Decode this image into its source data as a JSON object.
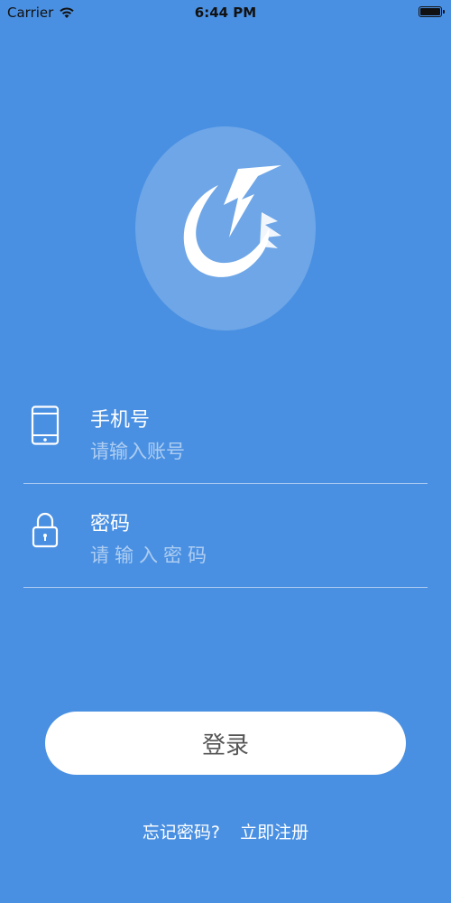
{
  "status_bar": {
    "carrier": "Carrier",
    "time": "6:44 PM"
  },
  "logo": {
    "icon": "bird-logo-icon"
  },
  "phone_field": {
    "label": "手机号",
    "placeholder": "请输入账号",
    "value": "",
    "icon": "phone-icon"
  },
  "password_field": {
    "label": "密码",
    "placeholder": "请输入密码",
    "value": "",
    "icon": "lock-icon"
  },
  "login_button": {
    "label": "登录"
  },
  "links": {
    "forgot_password": "忘记密码?",
    "register": "立即注册"
  },
  "colors": {
    "background": "#4a90e2",
    "button_bg": "#ffffff",
    "button_text": "#555555"
  }
}
